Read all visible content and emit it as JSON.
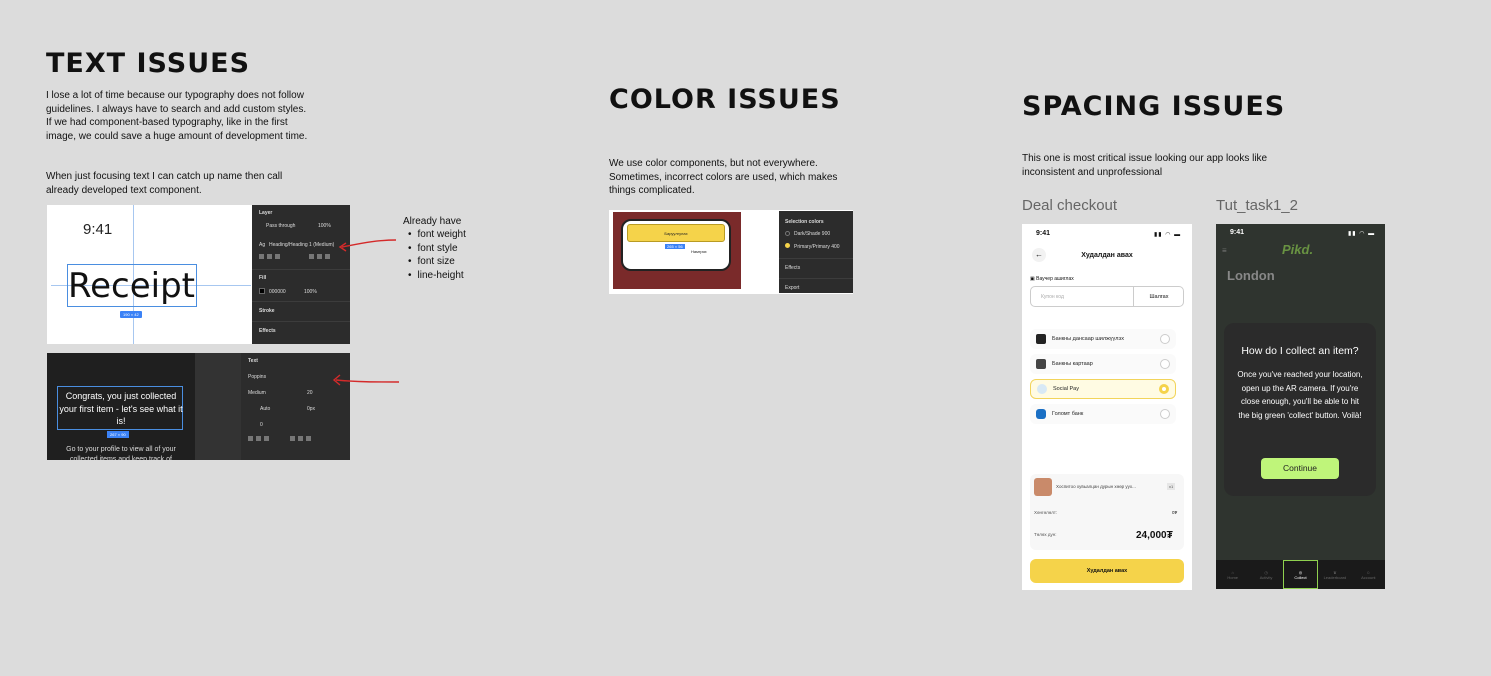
{
  "text_section": {
    "title": "TEXT ISSUES",
    "para1": "I lose a lot of time because our typography does not follow guidelines. I always have to search and add custom styles. If we had component-based typography, like in the first image, we could save a huge amount of development time.",
    "para2": "When just focusing text I can catch up name then call already developed text component.",
    "note_title": "Already have",
    "note_items": [
      "font weight",
      "font style",
      "font size",
      "line-height"
    ],
    "shot1": {
      "time": "9:41",
      "receipt": "Receipt",
      "size_badge": "190 × 42",
      "layer_label": "Layer",
      "pass_through": "Pass through",
      "opacity": "100%",
      "style_name": "Heading/Heading 1 (Medium)",
      "fill_label": "Fill",
      "fill_hex": "000000",
      "fill_opacity": "100%",
      "stroke_label": "Stroke",
      "effects_label": "Effects"
    },
    "shot2": {
      "congrats": "Congrats, you just collected your first item - let's see what it is!",
      "size_badge": "267 × 90",
      "sub": "Go to your profile to view all of your collected items and keep track of",
      "text_label": "Text",
      "font": "Poppins",
      "weight": "Medium",
      "size": "20",
      "auto": "Auto",
      "zero": "0",
      "zero_px": "0px",
      "zero2": "0"
    }
  },
  "color_section": {
    "title": "COLOR ISSUES",
    "para": "We use color components, but not everywhere. Sometimes, incorrect colors are used, which makes things complicated.",
    "button_label": "Баруулгулах",
    "size_badge": "265 × 56",
    "side_label": "Намгрях",
    "selection_label": "Selection colors",
    "color1": "Dark/Shade 900",
    "color2": "Primary/Primary 400",
    "effects": "Effects",
    "export": "Export",
    "colors": {
      "yellow": "#f5d34a",
      "maroon": "#7a2a2a",
      "dark": "#2a2a2a"
    }
  },
  "spacing_section": {
    "title": "SPACING ISSUES",
    "para": "This one is most critical issue looking our app looks like inconsistent and unprofessional",
    "deal_label": "Deal checkout",
    "tut_label": "Tut_task1_2",
    "deal": {
      "time": "9:41",
      "title": "Худалдан авах",
      "voucher": "Ваучер ашиглах",
      "coupon_placeholder": "Купон код",
      "apply": "Шалгах",
      "methods": [
        "Банкны дансаар шилжүүлэх",
        "Банкны картаар",
        "Social Pay",
        "Голомт банк"
      ],
      "product": "Хоспитоо хувьалцан дурын хөөр уух...",
      "qty": "x1",
      "discount_label": "Хөнгөлөлт:",
      "discount_value": "0₮",
      "total_label": "Төлөх дүн:",
      "total": "24,000₮",
      "buy_button": "Худалдан авах"
    },
    "tut": {
      "time": "9:41",
      "brand": "Pikd.",
      "city": "London",
      "question": "How do I collect an item?",
      "answer": "Once you've reached your location, open up the AR camera. If you're close enough, you'll be able to hit the big green 'collect' button. Voilà!",
      "continue": "Continue",
      "nav": [
        "Home",
        "Activity",
        "Collect",
        "Leaderboard",
        "Account"
      ]
    }
  }
}
